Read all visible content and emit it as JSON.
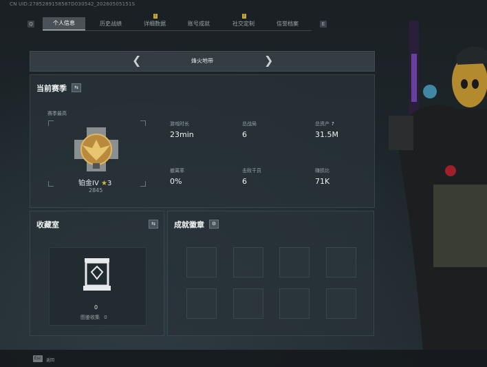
{
  "uid_line": "CN UID:2785289158587D030542_20260505151S",
  "tabs": [
    {
      "label": "个人信息",
      "active": true
    },
    {
      "label": "历史战绩",
      "active": false
    },
    {
      "label": "详细数据",
      "active": false,
      "badge": "!"
    },
    {
      "label": "账号成就",
      "active": false
    },
    {
      "label": "社交定制",
      "active": false,
      "badge": "!"
    },
    {
      "label": "信誉档案",
      "active": false
    }
  ],
  "tab_edge_left": "Q",
  "tab_edge_right": "E",
  "mode": {
    "label": "烽火地带"
  },
  "season": {
    "title": "当前赛季",
    "swap_icon": "⇆",
    "season_high_label": "赛季最高",
    "rank_name": "铂金IV",
    "rank_stars": "3",
    "rank_points": "2845",
    "stats": [
      {
        "label": "游戏时长",
        "value": "23min"
      },
      {
        "label": "总战局",
        "value": "6"
      },
      {
        "label": "总资产",
        "value": "31.5M",
        "help": "?"
      },
      {
        "label": "撤离率",
        "value": "0%"
      },
      {
        "label": "击败干员",
        "value": "6"
      },
      {
        "label": "赚损比",
        "value": "71K"
      }
    ]
  },
  "collection": {
    "title": "收藏室",
    "swap_icon": "⇆",
    "count": "0",
    "label": "图鉴收集",
    "label_value": "0"
  },
  "achievements": {
    "title": "成就徽章",
    "settings_icon": "⚙"
  },
  "bottom": {
    "esc_key": "Esc",
    "esc_label": "返回"
  },
  "colors": {
    "accent_gold": "#d9b64c",
    "panel": "#283237",
    "active_tab": "#4a5257"
  }
}
